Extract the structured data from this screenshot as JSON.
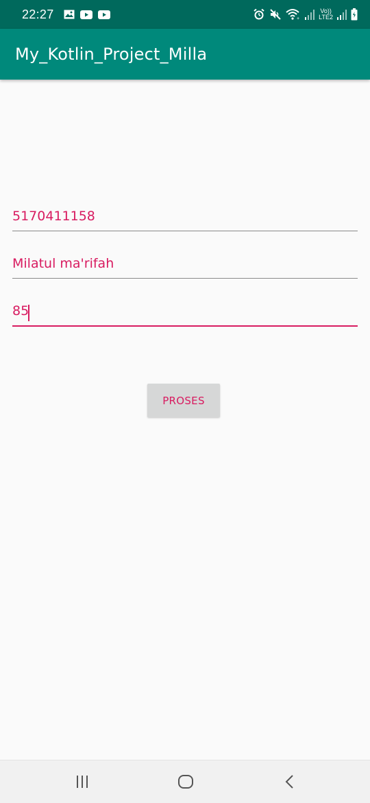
{
  "status_bar": {
    "time": "22:27",
    "left_icons": [
      "gallery-icon",
      "youtube-icon",
      "youtube-icon"
    ],
    "right_icons": [
      "alarm-icon",
      "mute-icon",
      "wifi-icon",
      "signal-icon",
      "lte-icon",
      "signal-icon",
      "battery-icon"
    ],
    "lte_label_top": "Vo))",
    "lte_label_bottom": "LTE2"
  },
  "app_bar": {
    "title": "My_Kotlin_Project_Milla"
  },
  "form": {
    "nim": "5170411158",
    "nama": "Milatul ma'rifah",
    "nilai": "85"
  },
  "button": {
    "label": "PROSES"
  },
  "nav_bar": {
    "icons": [
      "recents-icon",
      "home-icon",
      "back-icon"
    ]
  },
  "colors": {
    "status_bar": "#00695c",
    "app_bar": "#00897b",
    "accent": "#d81b60",
    "background": "#fafafa",
    "button": "#d6d7d7"
  }
}
